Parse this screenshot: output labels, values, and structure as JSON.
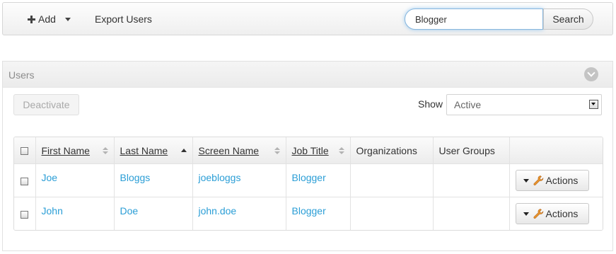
{
  "toolbar": {
    "add_label": "Add",
    "export_label": "Export Users",
    "search_value": "Blogger",
    "search_button": "Search"
  },
  "panel": {
    "title": "Users",
    "deactivate_label": "Deactivate",
    "show_label": "Show",
    "show_value": "Active"
  },
  "table": {
    "headers": {
      "first_name": "First Name",
      "last_name": "Last Name",
      "screen_name": "Screen Name",
      "job_title": "Job Title",
      "organizations": "Organizations",
      "user_groups": "User Groups"
    },
    "sorted_column": "Last Name",
    "sort_direction": "ascending",
    "rows": [
      {
        "first_name": "Joe",
        "last_name": "Bloggs",
        "screen_name": "joebloggs",
        "job_title": "Blogger",
        "organizations": "",
        "user_groups": "",
        "actions": "Actions"
      },
      {
        "first_name": "John",
        "last_name": "Doe",
        "screen_name": "john.doe",
        "job_title": "Blogger",
        "organizations": "",
        "user_groups": "",
        "actions": "Actions"
      }
    ]
  },
  "icons": {
    "add": "plus-icon",
    "collapse": "chevron-down-circle-icon",
    "actions": "wrench-icon"
  },
  "colors": {
    "link": "#2b9ed6",
    "search_focus": "#87b6dd",
    "wrench": "#e8952f"
  }
}
